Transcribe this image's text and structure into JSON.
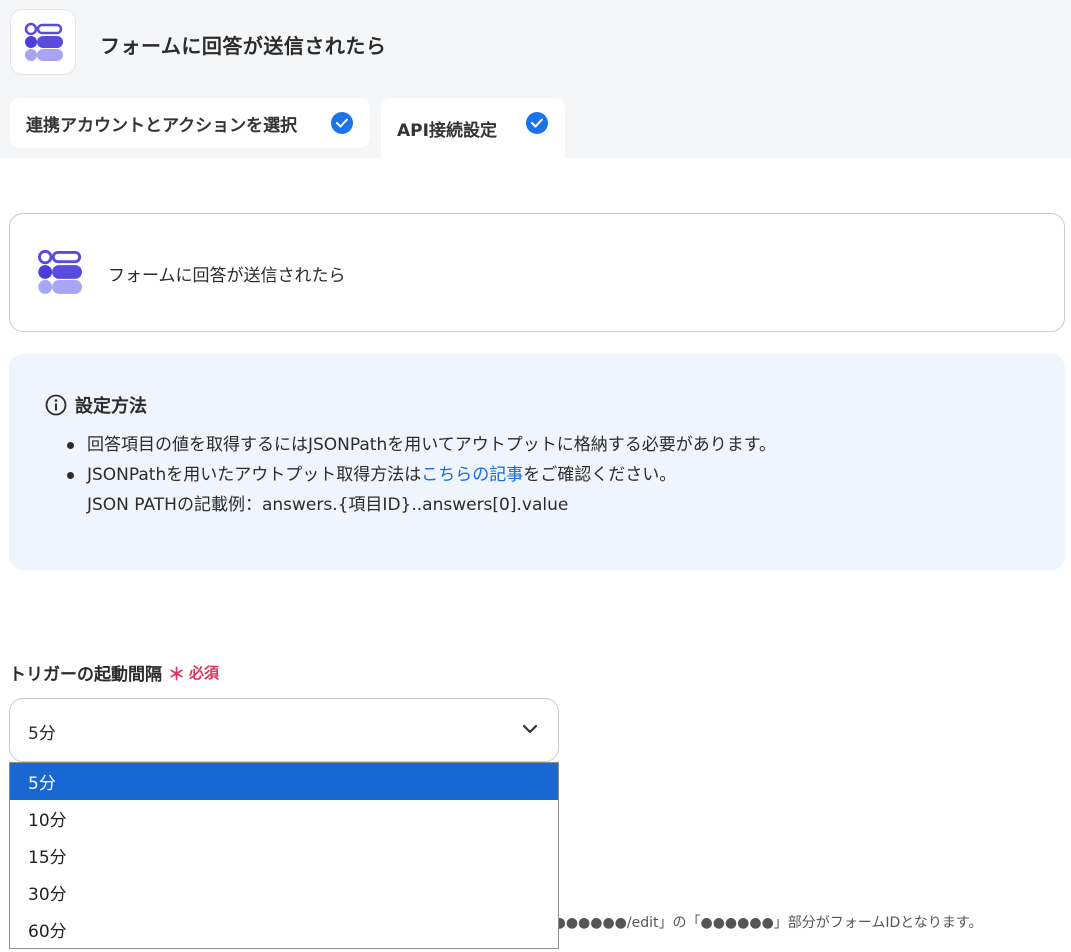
{
  "app": {
    "title": "フォームに回答が送信されたら"
  },
  "tabs": [
    {
      "label": "連携アカウントとアクションを選択"
    },
    {
      "label": "API接続設定"
    }
  ],
  "trigger": {
    "label": "フォームに回答が送信されたら"
  },
  "info": {
    "heading": "設定方法",
    "item1": "回答項目の値を取得するにはJSONPathを用いてアウトプットに格納する必要があります。",
    "item2_before": "JSONPathを用いたアウトプット取得方法は",
    "item2_link": "こちらの記事",
    "item2_after": "をご確認ください。",
    "item2_sub": "JSON PATHの記載例：answers.{項目ID}..answers[0].value"
  },
  "interval": {
    "label": "トリガーの起動間隔",
    "required_mark": "＊",
    "required_text": "必須",
    "selected": "5分",
    "options": [
      "5分",
      "10分",
      "15分",
      "30分",
      "60分"
    ]
  },
  "note": "d/●●●●●●/edit」の「●●●●●●」部分がフォームIDとなります。",
  "colors": {
    "accent": "#1a73e8",
    "selected_option": "#1967d2",
    "required": "#e0335d",
    "info_bg": "#eef5fd"
  }
}
